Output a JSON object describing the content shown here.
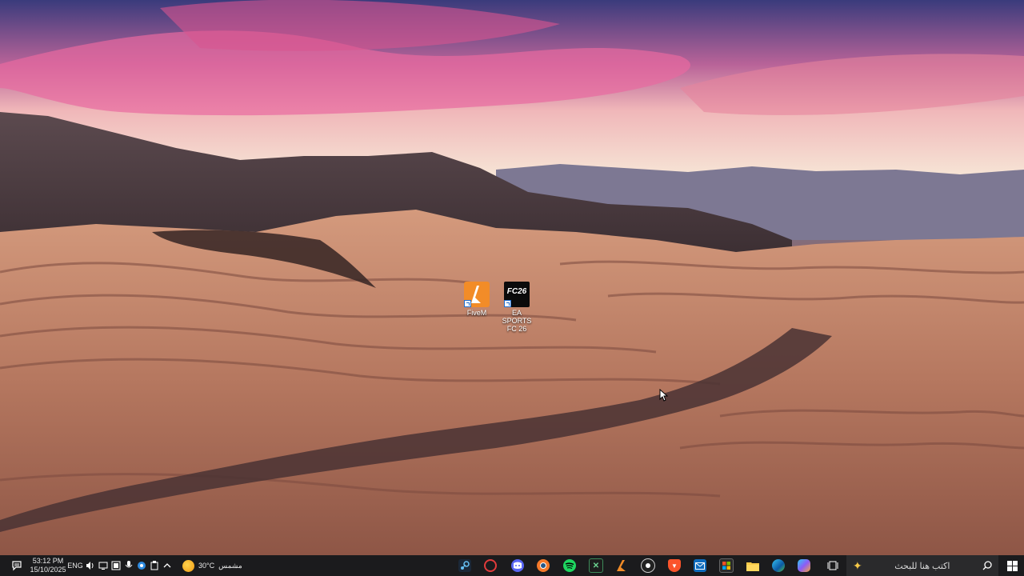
{
  "desktop": {
    "icons": [
      {
        "label": "FiveM",
        "icon": "fivem-logo-icon",
        "color": "#f28c28"
      },
      {
        "label": "EA SPORTS FC 26",
        "icon": "fc26-logo-icon",
        "logo_text": "FC26",
        "color": "#0b0b0b"
      }
    ]
  },
  "taskbar": {
    "search": {
      "placeholder": "اكتب هنا للبحث"
    },
    "apps": [
      {
        "name": "task-view-icon"
      },
      {
        "name": "copilot-icon"
      },
      {
        "name": "edge-icon"
      },
      {
        "name": "file-explorer-icon"
      },
      {
        "name": "microsoft-store-icon"
      },
      {
        "name": "mail-icon"
      },
      {
        "name": "brave-icon"
      },
      {
        "name": "davinci-icon"
      },
      {
        "name": "fivem-icon"
      },
      {
        "name": "excel-icon"
      },
      {
        "name": "spotify-icon"
      },
      {
        "name": "blender-icon"
      },
      {
        "name": "discord-icon"
      },
      {
        "name": "streaming-app-icon"
      },
      {
        "name": "steam-icon"
      }
    ],
    "weather": {
      "temp": "30°C",
      "condition": "مشمس",
      "icon": "sun-icon"
    },
    "tray": {
      "language": "ENG",
      "time": "53:12 PM",
      "date": "15/10/2025"
    }
  },
  "colors": {
    "taskbar_bg": "#1b1b1d",
    "search_bg": "#2a2a2c"
  }
}
